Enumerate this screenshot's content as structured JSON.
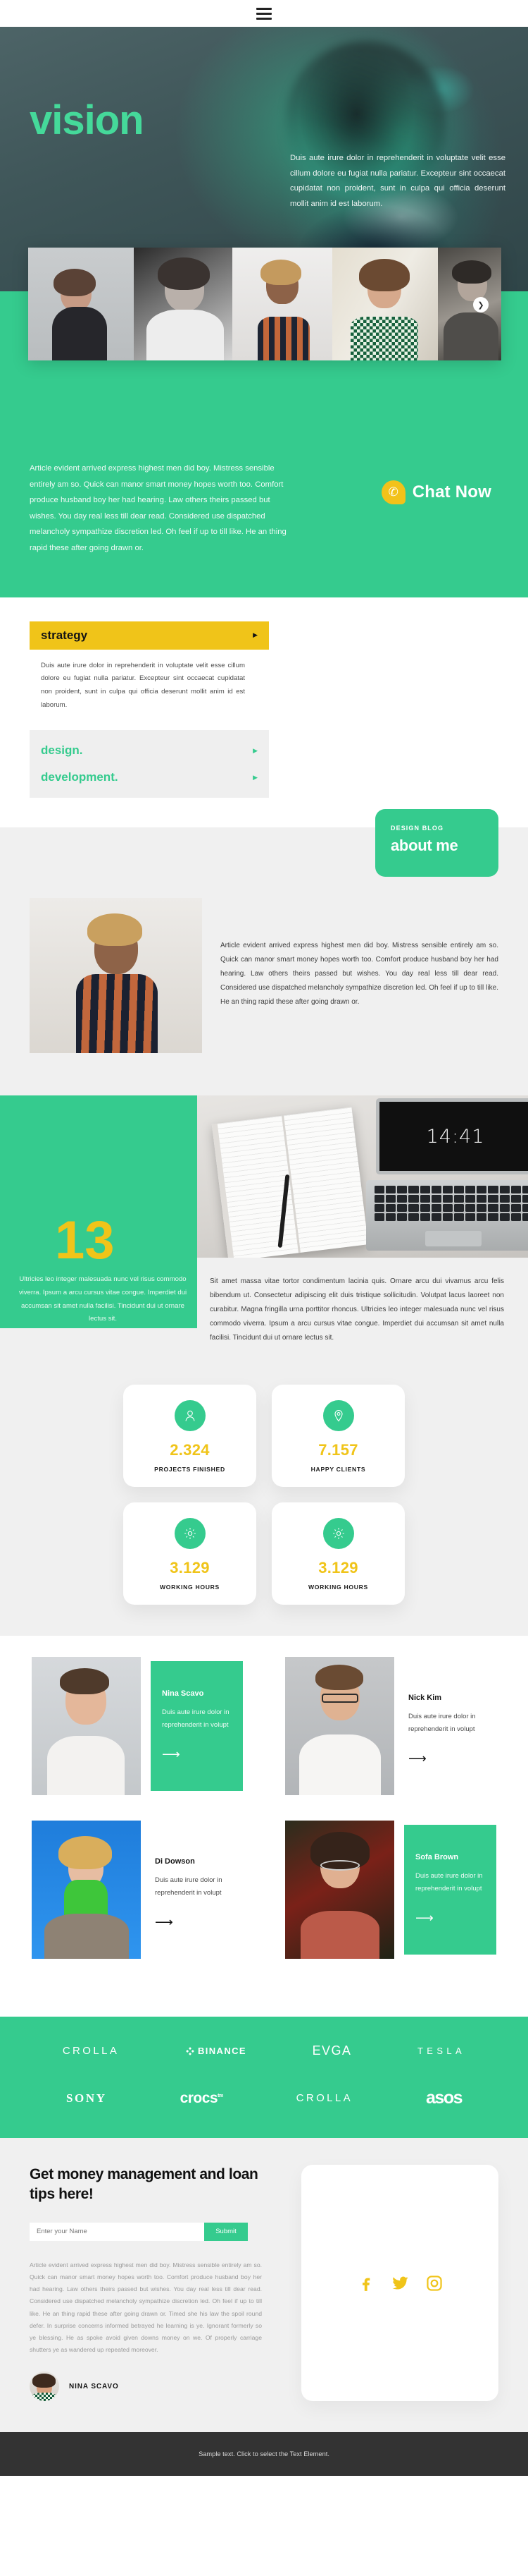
{
  "topbar": {
    "menu_icon": "hamburger-menu-icon"
  },
  "hero": {
    "title": "vision",
    "paragraph": "Duis aute irure dolor in reprehenderit in voluptate velit esse cillum dolore eu fugiat nulla pariatur. Excepteur sint occaecat cupidatat non proident, sunt in culpa qui officia deserunt mollit anim id est laborum.",
    "accent": "#45d99a"
  },
  "gallery": {
    "next_icon": "chevron-right-icon",
    "items": [
      "portrait-woman-dark-top",
      "portrait-woman-bw",
      "portrait-person-striped",
      "portrait-woman-smiling",
      "portrait-man-suit"
    ]
  },
  "intro": {
    "paragraph": "Article evident arrived express highest men did boy. Mistress sensible entirely am so. Quick can manor smart money hopes worth too. Comfort produce husband boy her had hearing. Law others theirs passed but wishes. You day real less till dear read. Considered use dispatched melancholy sympathize discretion led. Oh feel if up to till like. He an thing rapid these after going drawn or.",
    "chat_label": "Chat Now",
    "chat_icon": "phone-bubble-icon",
    "bg": "#35cb8e"
  },
  "accordion": {
    "items": [
      {
        "label": "strategy",
        "open": true,
        "arrow_icon": "triangle-right-icon",
        "body": "Duis aute irure dolor in reprehenderit in voluptate velit esse cillum dolore eu fugiat nulla pariatur. Excepteur sint occaecat cupidatat non proident, sunt in culpa qui officia deserunt mollit anim id est laborum."
      },
      {
        "label": "design.",
        "open": false,
        "arrow_icon": "triangle-right-icon",
        "body": ""
      },
      {
        "label": "development.",
        "open": false,
        "arrow_icon": "triangle-right-icon",
        "body": ""
      }
    ],
    "open_bg": "#f0c419",
    "closed_color": "#35cb8e"
  },
  "about": {
    "kicker": "DESIGN BLOG",
    "heading": "about me",
    "photo": "portrait-person-striped-shirt",
    "paragraph": "Article evident arrived express highest men did boy. Mistress sensible entirely am so. Quick can manor smart money hopes worth too. Comfort produce husband boy her had hearing. Law others theirs passed but wishes. You day real less till dear read. Considered use dispatched melancholy sympathize discretion led. Oh feel if up to till like. He an thing rapid these after going drawn or."
  },
  "thirteen": {
    "number": "13",
    "green_note": "Ultricies leo integer malesuada nunc vel risus commodo viverra. Ipsum a arcu cursus vitae congue. Imperdiet dui accumsan sit amet nulla facilisi. Tincidunt dui ut ornare lectus sit.",
    "clock": "14:41",
    "photo": "notebook-and-laptop-desk",
    "paragraph": "Sit amet massa vitae tortor condimentum lacinia quis. Ornare arcu dui vivamus arcu felis bibendum ut. Consectetur adipiscing elit duis tristique sollicitudin. Volutpat lacus laoreet non curabitur. Magna fringilla urna porttitor rhoncus. Ultricies leo integer malesuada nunc vel risus commodo viverra. Ipsum a arcu cursus vitae congue. Imperdiet dui accumsan sit amet nulla facilisi. Tincidunt dui ut ornare lectus sit."
  },
  "stats": {
    "number_color": "#f0c419",
    "items": [
      {
        "icon": "user-icon",
        "value": "2.324",
        "label": "PROJECTS FINISHED"
      },
      {
        "icon": "map-pin-icon",
        "value": "7.157",
        "label": "HAPPY CLIENTS"
      },
      {
        "icon": "gear-icon",
        "value": "3.129",
        "label": "WORKING HOURS"
      },
      {
        "icon": "gear-icon",
        "value": "3.129",
        "label": "WORKING HOURS"
      }
    ]
  },
  "team": {
    "arrow_icon": "arrow-right-icon",
    "members": [
      {
        "name": "Nina Scavo",
        "desc": "Duis aute irure dolor in reprehenderit in volupt",
        "highlighted": true,
        "photo": "portrait-nina"
      },
      {
        "name": "Nick Kim",
        "desc": "Duis aute irure dolor in reprehenderit in volupt",
        "highlighted": false,
        "photo": "portrait-nick"
      },
      {
        "name": "Di Dowson",
        "desc": "Duis aute irure dolor in reprehenderit in volupt",
        "highlighted": false,
        "photo": "portrait-di"
      },
      {
        "name": "Sofa Brown",
        "desc": "Duis aute irure dolor in reprehenderit in volupt",
        "highlighted": true,
        "photo": "portrait-sofa"
      }
    ]
  },
  "brands": {
    "bg": "#35cb8e",
    "row1": [
      "CROLLA",
      "BINANCE",
      "EVGA",
      "TESLA"
    ],
    "row2": [
      "SONY",
      "crocs",
      "CROLLA",
      "asos"
    ]
  },
  "newsletter": {
    "title": "Get money management and loan tips here!",
    "input_placeholder": "Enter your Name",
    "input_value": "",
    "submit_label": "Submit",
    "paragraph": "Article evident arrived express highest men did boy. Mistress sensible entirely am so. Quick can manor smart money hopes worth too. Comfort produce husband boy her had hearing. Law others theirs passed but wishes. You day real less till dear read. Considered use dispatched melancholy sympathize discretion led. Oh feel if up to till like. He an thing rapid these after going drawn or. Timed she his law the spoil round defer. In surprise concerns informed betrayed he learning is ye. Ignorant formerly so ye blessing. He as spoke avoid given downs money on we. Of properly carriage shutters ye as wandered up repeated moreover.",
    "author": "NINA SCAVO",
    "author_avatar": "avatar-nina-scavo",
    "socials": [
      {
        "name": "facebook-icon"
      },
      {
        "name": "twitter-icon"
      },
      {
        "name": "instagram-icon"
      }
    ],
    "social_color": "#f0c419"
  },
  "footer": {
    "text": "Sample text. Click to select the Text Element.",
    "bg": "#333333"
  }
}
